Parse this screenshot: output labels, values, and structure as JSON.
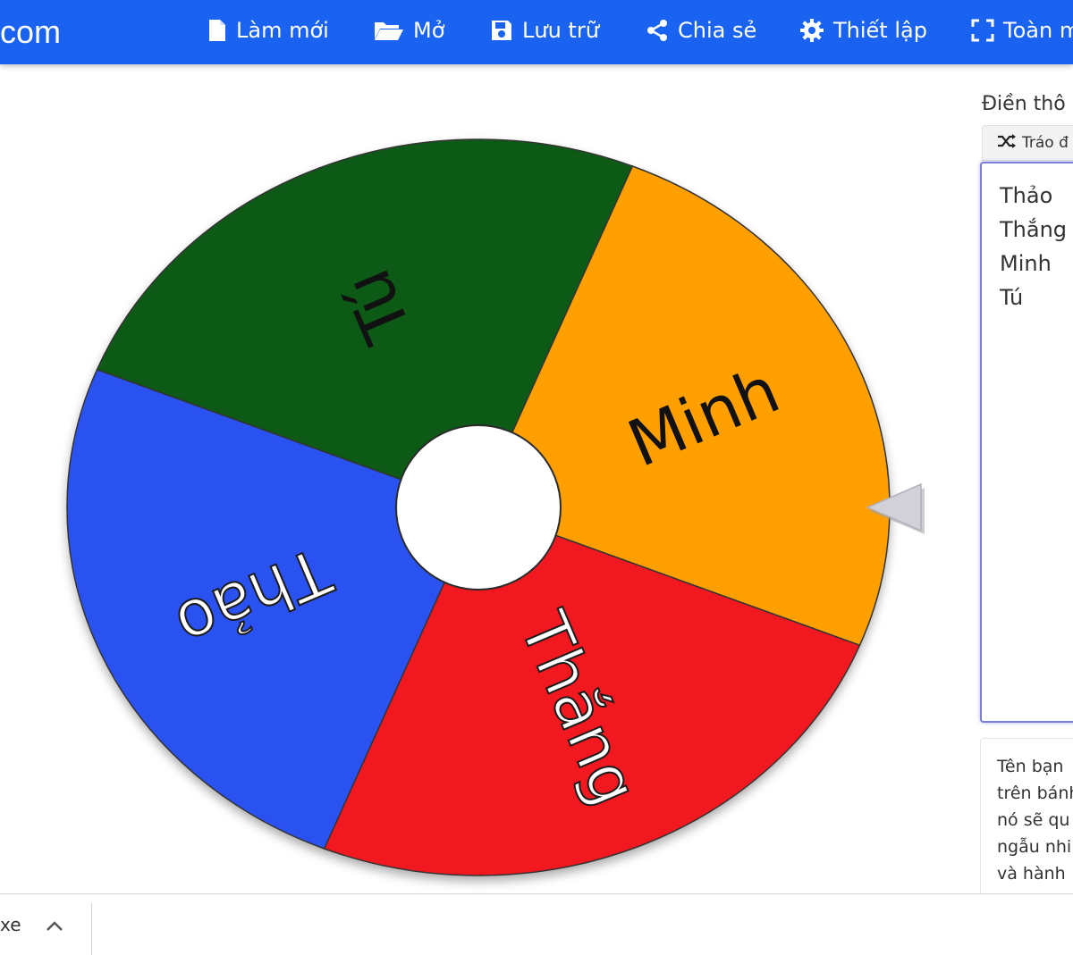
{
  "navbar": {
    "brand": "com",
    "items": [
      {
        "label": "Làm mới",
        "icon": "file-icon"
      },
      {
        "label": "Mở",
        "icon": "folder-open-icon"
      },
      {
        "label": "Lưu trữ",
        "icon": "save-icon"
      },
      {
        "label": "Chia sẻ",
        "icon": "share-icon"
      },
      {
        "label": "Thiết lập",
        "icon": "gear-icon"
      },
      {
        "label": "Toàn m",
        "icon": "fullscreen-icon"
      }
    ]
  },
  "wheel": {
    "segments": [
      {
        "label": "Thảo",
        "color": "#2a52f0"
      },
      {
        "label": "Tú",
        "color": "#0c5a16"
      },
      {
        "label": "Minh",
        "color": "#ffa000"
      },
      {
        "label": "Thắng",
        "color": "#f2181f"
      }
    ],
    "pointer_icon": "pointer-triangle-icon"
  },
  "panel": {
    "label": "Điền thô",
    "shuffle_label": "Tráo đ",
    "names": [
      "Thảo",
      "Thắng",
      "Minh",
      "Tú"
    ],
    "description_lines": [
      "Tên bạn",
      "trên bánh",
      "nó sẽ qu",
      "ngẫu nhi",
      "và hành"
    ]
  },
  "download_bar": {
    "file_label": "xe"
  }
}
